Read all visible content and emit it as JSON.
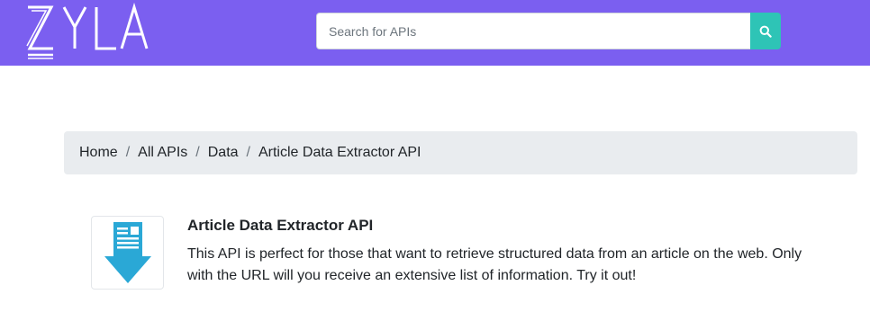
{
  "brand": {
    "logo_text": "ZYLA",
    "header_color": "#7b5ff0",
    "accent_color": "#2ec4b6"
  },
  "search": {
    "placeholder": "Search for APIs",
    "value": "",
    "button_icon": "search-icon"
  },
  "breadcrumb": {
    "items": [
      "Home",
      "All APIs",
      "Data",
      "Article Data Extractor API"
    ],
    "separator": "/"
  },
  "api": {
    "title": "Article Data Extractor API",
    "description": "This API is perfect for those that want to retrieve structured data from an article on the web. Only with the URL will you receive an extensive list of information. Try it out!",
    "icon": "document-download-icon"
  }
}
